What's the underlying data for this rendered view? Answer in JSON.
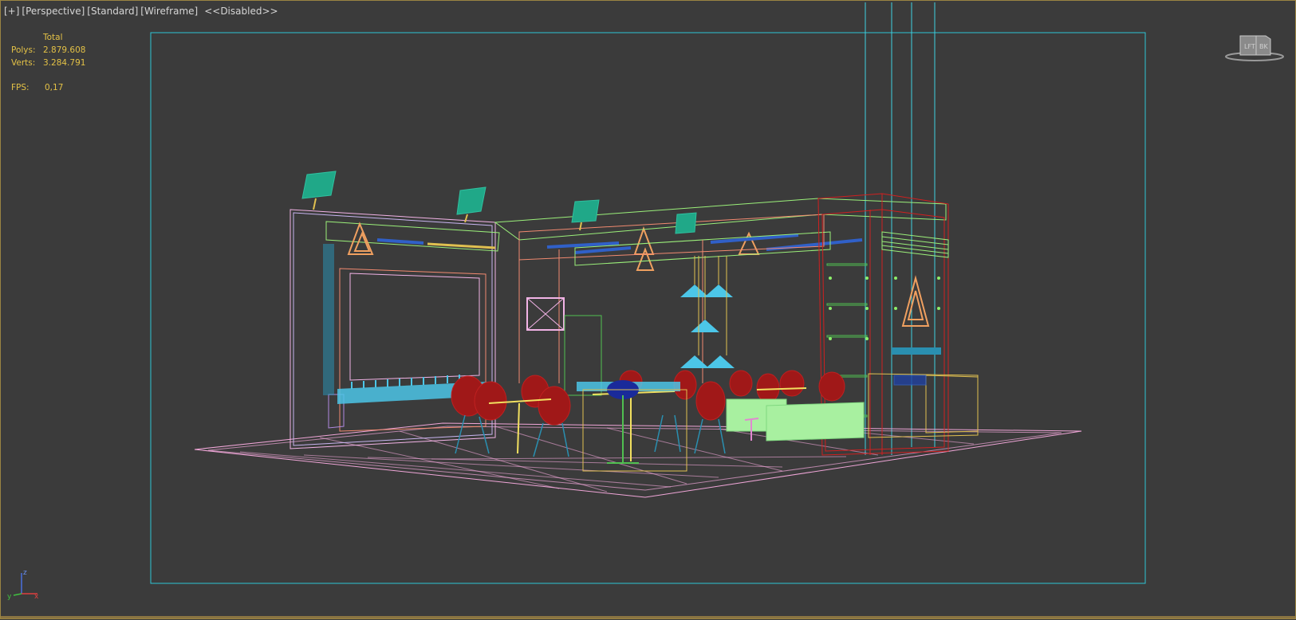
{
  "viewport": {
    "labels": [
      "[+]",
      "[Perspective]",
      "[Standard]",
      "[Wireframe]",
      "<<Disabled>>"
    ]
  },
  "stats": {
    "header": "Total",
    "polys_label": "Polys:",
    "polys_value": "2.879.608",
    "verts_label": "Verts:",
    "verts_value": "3.284.791",
    "fps_label": "FPS:",
    "fps_value": "0,17"
  },
  "viewcube": {
    "left_face": "LFT",
    "back_face": "BK"
  },
  "axis": {
    "z": "z",
    "y": "y",
    "x": "x"
  },
  "colors": {
    "background": "#3b3b3b",
    "safe_frame": "#2ec4d6",
    "floor": "#f0a6d8",
    "chairs": "#a01818",
    "stats_text": "#e3c146",
    "accent_border": "#9a8442"
  }
}
